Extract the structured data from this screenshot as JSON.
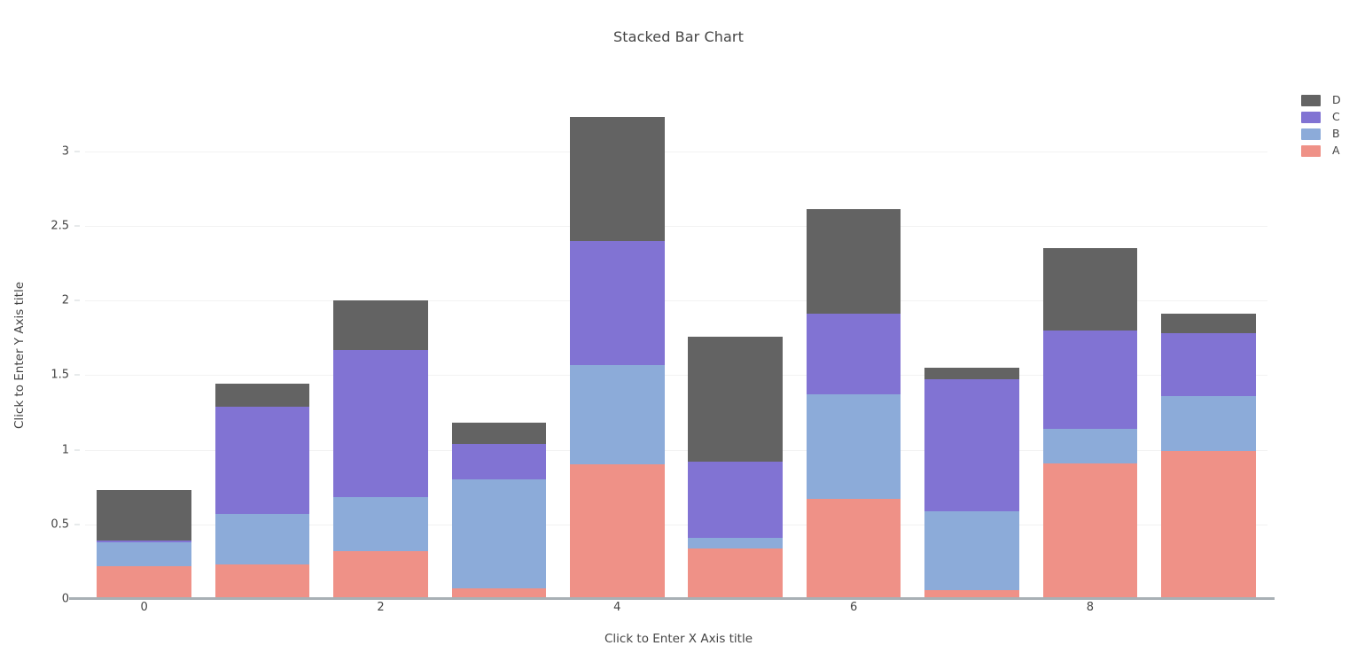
{
  "chart": {
    "title": "Stacked Bar Chart",
    "xlabel": "Click to Enter X Axis title",
    "ylabel": "Click to Enter Y Axis title"
  },
  "legend": {
    "position": "right",
    "items": [
      {
        "label": "D",
        "color": "#636363"
      },
      {
        "label": "C",
        "color": "#8173d3"
      },
      {
        "label": "B",
        "color": "#8cabd9"
      },
      {
        "label": "A",
        "color": "#ef9187"
      }
    ]
  },
  "axes": {
    "y_ticks": [
      "0",
      "0.5",
      "1",
      "1.5",
      "2",
      "2.5",
      "3"
    ],
    "y_tick_values": [
      0,
      0.5,
      1,
      1.5,
      2,
      2.5,
      3
    ],
    "x_ticks": [
      "0",
      "2",
      "4",
      "6",
      "8"
    ],
    "x_tick_values": [
      0,
      2,
      4,
      6,
      8
    ]
  },
  "chart_data": {
    "type": "bar",
    "barmode": "stack",
    "title": "Stacked Bar Chart",
    "xlabel": "Click to Enter X Axis title",
    "ylabel": "Click to Enter Y Axis title",
    "categories": [
      0,
      1,
      2,
      3,
      4,
      5,
      6,
      7,
      8,
      9
    ],
    "xlim": [
      -0.5,
      9.5
    ],
    "ylim": [
      0,
      3.36
    ],
    "grid": true,
    "legend_position": "right",
    "series": [
      {
        "name": "A",
        "color": "#ef9187",
        "values": [
          0.22,
          0.23,
          0.32,
          0.07,
          0.9,
          0.34,
          0.67,
          0.06,
          0.91,
          0.99
        ]
      },
      {
        "name": "B",
        "color": "#8cabd9",
        "values": [
          0.16,
          0.34,
          0.36,
          0.73,
          0.67,
          0.07,
          0.7,
          0.53,
          0.23,
          0.37
        ]
      },
      {
        "name": "C",
        "color": "#8173d3",
        "values": [
          0.01,
          0.72,
          0.99,
          0.24,
          0.83,
          0.51,
          0.54,
          0.88,
          0.66,
          0.42
        ]
      },
      {
        "name": "D",
        "color": "#636363",
        "values": [
          0.34,
          0.15,
          0.33,
          0.14,
          0.83,
          0.84,
          0.7,
          0.08,
          0.55,
          0.13
        ]
      }
    ],
    "totals": [
      0.73,
      1.44,
      2.0,
      1.18,
      3.23,
      1.76,
      2.61,
      1.55,
      2.35,
      1.91
    ]
  }
}
